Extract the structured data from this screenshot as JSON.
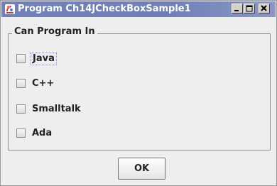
{
  "window": {
    "title": "Program Ch14JCheckBoxSample1",
    "controls": {
      "minimize": "minimize",
      "maximize": "maximize",
      "close": "close"
    }
  },
  "panel": {
    "legend": "Can Program In",
    "checkboxes": [
      {
        "label": "Java",
        "checked": false,
        "focused": true
      },
      {
        "label": "C++",
        "checked": false,
        "focused": false
      },
      {
        "label": "Smalltalk",
        "checked": false,
        "focused": false
      },
      {
        "label": "Ada",
        "checked": false,
        "focused": false
      }
    ]
  },
  "buttons": {
    "ok_label": "OK"
  },
  "colors": {
    "titlebar": "#7280b8",
    "background": "#eeeeee",
    "title_text": "#ffffff"
  }
}
